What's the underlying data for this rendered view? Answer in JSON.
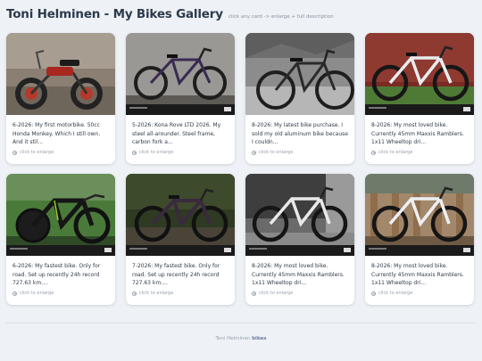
{
  "header": {
    "title": "Toni Helminen - My Bikes Gallery",
    "subtitle": "click any card -> enlarge + full description"
  },
  "cards": [
    {
      "description": "6-2026: My first motorbike. 50cc Honda Monkey. Which I still own. And it stil...",
      "enlarge_label": "click to enlarge"
    },
    {
      "description": "5-2026: Kona Rove LTD 2026. My steel all-arounder. Steel frame, carbon fork a...",
      "enlarge_label": "click to enlarge"
    },
    {
      "description": "8-2026: My latest bike purchase. I sold my old aluminum bike because I couldn...",
      "enlarge_label": "click to enlarge"
    },
    {
      "description": "8-2026: My most loved bike. Currently 45mm Maxxis Ramblers. 1x11 Wheeltop dri...",
      "enlarge_label": "click to enlarge"
    },
    {
      "description": "6-2026: My fastest bike. Only for road. Set up recently 24h record 727.63 km....",
      "enlarge_label": "click to enlarge"
    },
    {
      "description": "7-2026: My fastest bike. Only for road. Set up recently 24h record 727.63 km....",
      "enlarge_label": "click to enlarge"
    },
    {
      "description": "8-2026: My most loved bike. Currently 45mm Maxxis Ramblers. 1x11 Wheeltop dri...",
      "enlarge_label": "click to enlarge"
    },
    {
      "description": "8-2026: My most loved bike. Currently 45mm Maxxis Ramblers. 1x11 Wheeltop dri...",
      "enlarge_label": "click to enlarge"
    }
  ],
  "footer": {
    "prefix": "Toni Helminen",
    "suffix": "bikes"
  }
}
